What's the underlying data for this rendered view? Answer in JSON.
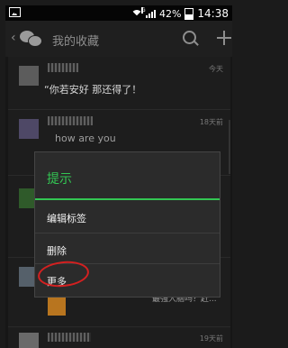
{
  "status_bar": {
    "battery_percent": "42%",
    "time": "14:38"
  },
  "app_bar": {
    "title": "我的收藏"
  },
  "favorites": [
    {
      "time": "今天",
      "text": "“你若安好 那还得了！"
    },
    {
      "time": "18天前",
      "text": "how are you"
    },
    {
      "time": "",
      "text": ""
    },
    {
      "time": "",
      "text": "最强大脑吗？赶..."
    },
    {
      "time": "19天前",
      "text": ""
    }
  ],
  "dialog": {
    "title": "提示",
    "items": [
      "编辑标签",
      "删除",
      "更多"
    ]
  },
  "colors": {
    "accent": "#33c653",
    "annotation": "#d42020"
  }
}
